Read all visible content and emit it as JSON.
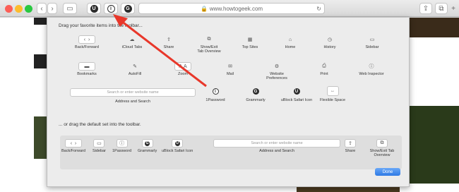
{
  "browser": {
    "url": "www.howtogeek.com"
  },
  "sheet": {
    "heading_favorites": "Drag your favorite items into the toolbar...",
    "heading_default": "... or drag the default set into the toolbar.",
    "items": [
      {
        "label": "Back/Forward",
        "icon": "back-forward-icon"
      },
      {
        "label": "iCloud Tabs",
        "icon": "cloud-icon"
      },
      {
        "label": "Share",
        "icon": "share-icon"
      },
      {
        "label": "Show/Exit\nTab Overview",
        "icon": "tab-overview-icon"
      },
      {
        "label": "Top Sites",
        "icon": "top-sites-icon"
      },
      {
        "label": "Home",
        "icon": "home-icon"
      },
      {
        "label": "History",
        "icon": "history-icon"
      },
      {
        "label": "Sidebar",
        "icon": "sidebar-icon"
      },
      {
        "label": "Bookmarks",
        "icon": "bookmarks-icon"
      },
      {
        "label": "AutoFill",
        "icon": "autofill-icon"
      },
      {
        "label": "Zoom",
        "icon": "zoom-icon"
      },
      {
        "label": "Mail",
        "icon": "mail-icon"
      },
      {
        "label": "Website\nPreferences",
        "icon": "gear-icon"
      },
      {
        "label": "Print",
        "icon": "print-icon"
      },
      {
        "label": "Web Inspector",
        "icon": "web-inspector-icon"
      }
    ],
    "address_placeholder": "Search or enter website name",
    "address_label": "Address and Search",
    "extensions": [
      {
        "label": "1Password",
        "icon": "1password-icon"
      },
      {
        "label": "Grammarly",
        "icon": "grammarly-icon"
      },
      {
        "label": "uBlock Safari Icon",
        "icon": "ublock-icon"
      },
      {
        "label": "Flexible Space",
        "icon": "flexible-space-icon"
      }
    ],
    "default_set": [
      {
        "label": "Back/Forward"
      },
      {
        "label": "Sidebar"
      },
      {
        "label": "1Password"
      },
      {
        "label": "Grammarly"
      },
      {
        "label": "uBlock Safari Icon"
      },
      {
        "label": "Address and Search"
      },
      {
        "label": "Share"
      },
      {
        "label": "Show/Exit Tab Overview"
      }
    ],
    "default_placeholder": "Search or enter website name",
    "done_label": "Done"
  },
  "colors": {
    "annotation_arrow": "#e8372a",
    "done_button": "#2f7ae5"
  }
}
